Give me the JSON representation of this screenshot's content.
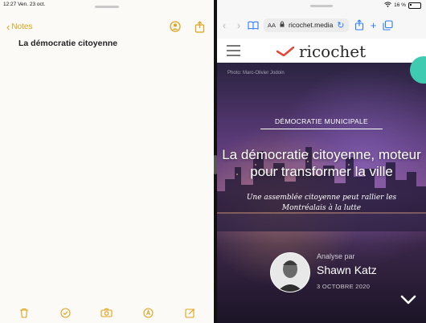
{
  "left_pane": {
    "status_time": "12:27  Ven. 23 oct.",
    "back_label": "Notes",
    "note_title": "La démocratie citoyenne",
    "icons": {
      "share_person": "person-add-icon",
      "share": "share-icon",
      "trash": "trash-icon",
      "checklist": "checklist-icon",
      "camera": "camera-icon",
      "markup": "pen-tip-icon",
      "compose": "compose-icon"
    },
    "accent": "#e0a21a"
  },
  "right_pane": {
    "status_battery": "16 %",
    "address": "ricochet.media",
    "aa_label": "AA",
    "site_logo": "ricochet",
    "photo_credit": "Photo: Marc-Olivier Jodoin",
    "category": "DÉMOCRATIE MUNICIPALE",
    "headline": "La démocratie citoyenne, moteur pour transformer la ville",
    "subtitle": "Une assemblée citoyenne peut rallier les Montréalais à la lutte",
    "author_label": "Analyse par",
    "author_name": "Shawn Katz",
    "date": "3 OCTOBRE 2020",
    "accent": "#2f7cf6",
    "brand_accent": "#e5483b"
  }
}
